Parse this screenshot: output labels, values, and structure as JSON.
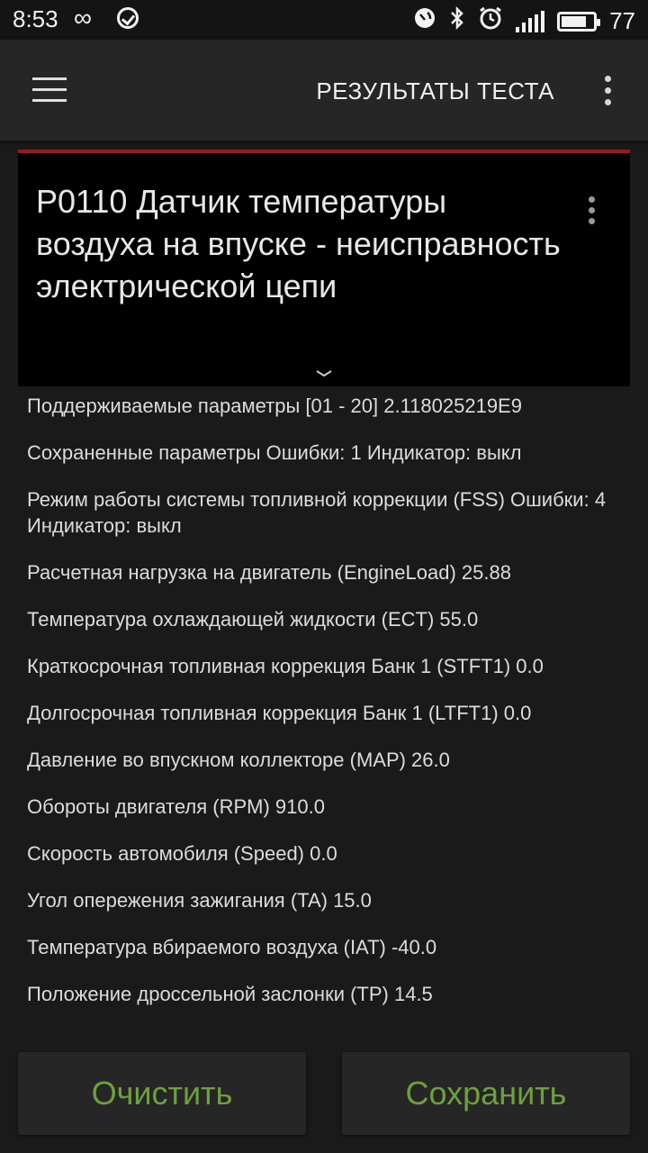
{
  "status_bar": {
    "time": "8:53",
    "battery": "77",
    "icons": [
      "infinity-icon",
      "check-circle-icon",
      "nfc-icon",
      "bluetooth-icon",
      "alarm-icon",
      "signal-icon",
      "battery-icon"
    ]
  },
  "app_bar": {
    "title": "РЕЗУЛЬТАТЫ ТЕСТА"
  },
  "error_card": {
    "title": "P0110 Датчик температуры воздуха на впуске - неисправность электрической цепи",
    "accent_color": "#9b1b1b"
  },
  "params": [
    "Поддерживаемые параметры [01 - 20] 2.118025219E9",
    "Сохраненные параметры Ошибки: 1 Индикатор: выкл",
    "Режим работы системы топливной коррекции (FSS) Ошибки: 4 Индикатор: выкл",
    "Расчетная нагрузка на двигатель (EngineLoad) 25.88",
    "Температура охлаждающей жидкости (ECT) 55.0",
    "Краткосрочная топливная коррекция Банк 1 (STFT1) 0.0",
    "Долгосрочная топливная коррекция Банк 1 (LTFT1) 0.0",
    "Давление во впускном коллекторе (MAP) 26.0",
    "Обороты двигателя (RPM) 910.0",
    "Скорость автомобиля (Speed) 0.0",
    "Угол опережения зажигания (TA) 15.0",
    "Температура вбираемого воздуха (IAT) -40.0",
    "Положение дроссельной заслонки (TP) 14.5"
  ],
  "buttons": {
    "clear": "Очистить",
    "save": "Сохранить",
    "color": "#6ea03c"
  }
}
